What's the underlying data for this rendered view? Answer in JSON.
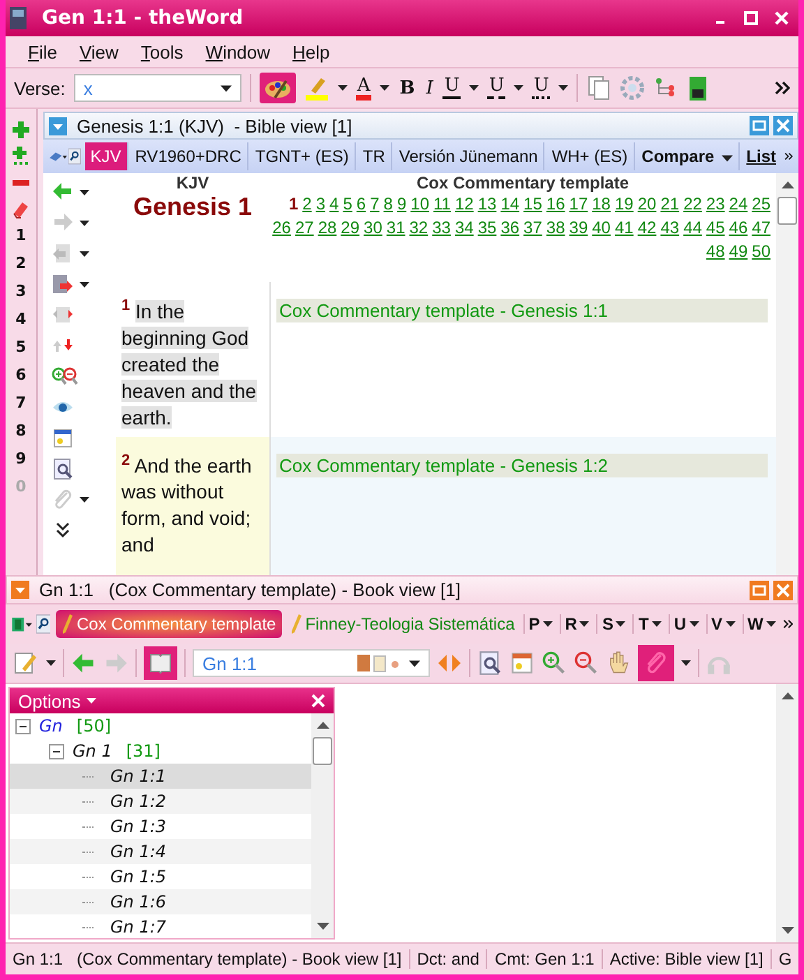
{
  "window": {
    "title": "Gen 1:1 - theWord"
  },
  "menu": [
    "File",
    "View",
    "Tools",
    "Window",
    "Help"
  ],
  "toolbar": {
    "verse_label": "Verse:",
    "verse_value": "x",
    "format_buttons": [
      {
        "label": "A",
        "kind": "color"
      },
      {
        "label": "B",
        "kind": "bold"
      },
      {
        "label": "I",
        "kind": "italic"
      },
      {
        "label": "U",
        "kind": "solid"
      },
      {
        "label": "U",
        "kind": "dashed"
      },
      {
        "label": "U",
        "kind": "dotted"
      }
    ]
  },
  "number_strip": [
    {
      "label": "1",
      "disabled": false
    },
    {
      "label": "2",
      "disabled": false
    },
    {
      "label": "3",
      "disabled": false
    },
    {
      "label": "4",
      "disabled": false
    },
    {
      "label": "5",
      "disabled": false
    },
    {
      "label": "6",
      "disabled": false
    },
    {
      "label": "7",
      "disabled": false
    },
    {
      "label": "8",
      "disabled": false
    },
    {
      "label": "9",
      "disabled": false
    },
    {
      "label": "0",
      "disabled": true
    }
  ],
  "bible_view": {
    "title": "Genesis 1:1 (KJV)  - Bible view [1]",
    "modules": [
      {
        "label": "KJV",
        "kind": "tab",
        "selected": true
      },
      {
        "label": "RV1960+DRC",
        "kind": "tab",
        "selected": false
      },
      {
        "label": "TGNT+ (ES)",
        "kind": "tab",
        "selected": false
      },
      {
        "label": "TR",
        "kind": "tab",
        "selected": false
      },
      {
        "label": "Versión Jünemann",
        "kind": "tab",
        "selected": false
      },
      {
        "label": "WH+ (ES)",
        "kind": "tab",
        "selected": false
      },
      {
        "label": "Compare",
        "kind": "menu"
      },
      {
        "label": "List",
        "kind": "link"
      }
    ],
    "columns": [
      "KJV",
      "Cox Commentary template"
    ],
    "book_title": "Genesis 1",
    "chapters": [
      {
        "label": "1",
        "selected": true
      },
      {
        "label": "2",
        "selected": false
      },
      {
        "label": "3",
        "selected": false
      },
      {
        "label": "4",
        "selected": false
      },
      {
        "label": "5",
        "selected": false
      },
      {
        "label": "6",
        "selected": false
      },
      {
        "label": "7",
        "selected": false
      },
      {
        "label": "8",
        "selected": false
      },
      {
        "label": "9",
        "selected": false
      },
      {
        "label": "10",
        "selected": false
      },
      {
        "label": "11",
        "selected": false
      },
      {
        "label": "12",
        "selected": false
      },
      {
        "label": "13",
        "selected": false
      },
      {
        "label": "14",
        "selected": false
      },
      {
        "label": "15",
        "selected": false
      },
      {
        "label": "16",
        "selected": false
      },
      {
        "label": "17",
        "selected": false
      },
      {
        "label": "18",
        "selected": false
      },
      {
        "label": "19",
        "selected": false
      },
      {
        "label": "20",
        "selected": false
      },
      {
        "label": "21",
        "selected": false
      },
      {
        "label": "22",
        "selected": false
      },
      {
        "label": "23",
        "selected": false
      },
      {
        "label": "24",
        "selected": false
      },
      {
        "label": "25",
        "selected": false
      },
      {
        "label": "26",
        "selected": false
      },
      {
        "label": "27",
        "selected": false
      },
      {
        "label": "28",
        "selected": false
      },
      {
        "label": "29",
        "selected": false
      },
      {
        "label": "30",
        "selected": false
      },
      {
        "label": "31",
        "selected": false
      },
      {
        "label": "32",
        "selected": false
      },
      {
        "label": "33",
        "selected": false
      },
      {
        "label": "34",
        "selected": false
      },
      {
        "label": "35",
        "selected": false
      },
      {
        "label": "36",
        "selected": false
      },
      {
        "label": "37",
        "selected": false
      },
      {
        "label": "38",
        "selected": false
      },
      {
        "label": "39",
        "selected": false
      },
      {
        "label": "40",
        "selected": false
      },
      {
        "label": "41",
        "selected": false
      },
      {
        "label": "42",
        "selected": false
      },
      {
        "label": "43",
        "selected": false
      },
      {
        "label": "44",
        "selected": false
      },
      {
        "label": "45",
        "selected": false
      },
      {
        "label": "46",
        "selected": false
      },
      {
        "label": "47",
        "selected": false
      },
      {
        "label": "48",
        "selected": false
      },
      {
        "label": "49",
        "selected": false
      },
      {
        "label": "50",
        "selected": false
      }
    ],
    "verses": [
      {
        "number": "1",
        "text": "In the beginning God created the heaven and the earth.",
        "highlighted": true,
        "selected": false,
        "commentary": "Cox Commentary template - Genesis 1:1"
      },
      {
        "number": "2",
        "text": "And the earth was without form, and void; and",
        "highlighted": false,
        "selected": true,
        "commentary": "Cox Commentary template - Genesis 1:2"
      }
    ]
  },
  "book_view": {
    "title": "Gn 1:1   (Cox Commentary template) - Book view [1]",
    "tabs": [
      {
        "label": "Cox Commentary template",
        "selected": true
      },
      {
        "label": "Finney-Teologia Sistemática",
        "selected": false
      }
    ],
    "letter_menus": [
      "P",
      "R",
      "S",
      "T",
      "U",
      "V",
      "W"
    ],
    "reference": "Gn 1:1",
    "options": {
      "title": "Options",
      "tree": [
        {
          "label": "Gn",
          "count": "[50]",
          "expanded": true,
          "selected": false,
          "children": [
            {
              "label": "Gn 1",
              "count": "[31]",
              "expanded": true,
              "selected": false,
              "children": [
                {
                  "label": "Gn 1:1",
                  "selected": true
                },
                {
                  "label": "Gn 1:2",
                  "selected": false
                },
                {
                  "label": "Gn 1:3",
                  "selected": false
                },
                {
                  "label": "Gn 1:4",
                  "selected": false
                },
                {
                  "label": "Gn 1:5",
                  "selected": false
                },
                {
                  "label": "Gn 1:6",
                  "selected": false
                },
                {
                  "label": "Gn 1:7",
                  "selected": false
                }
              ]
            }
          ]
        }
      ]
    }
  },
  "status_bar": [
    "Gn 1:1   (Cox Commentary template) - Book view [1]",
    "Dct: and",
    "Cmt: Gen 1:1",
    "Active: Bible view [1]",
    "G"
  ]
}
